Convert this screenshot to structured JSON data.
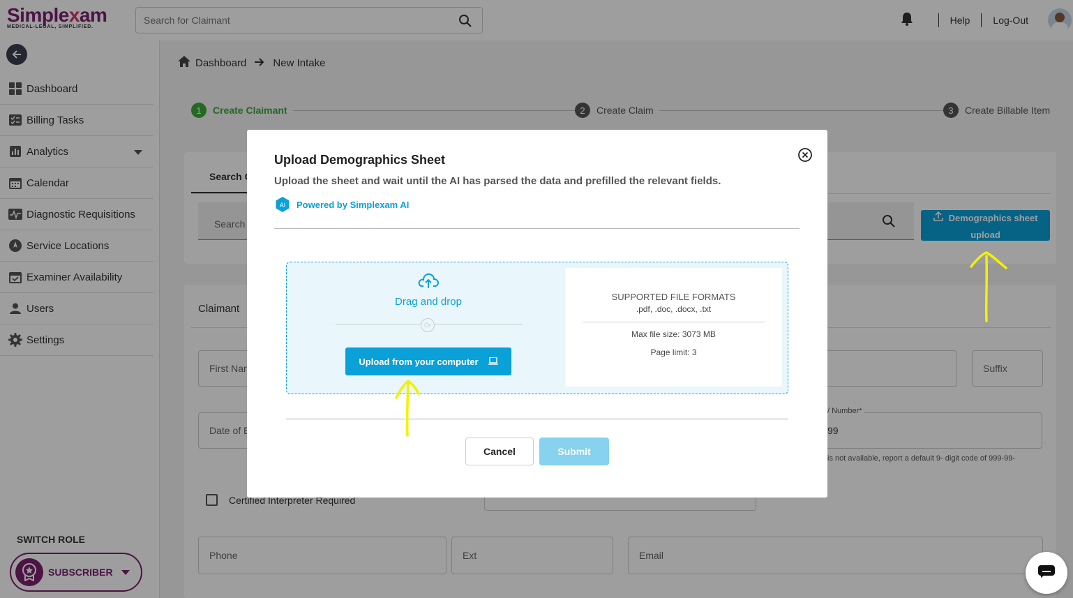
{
  "brand": {
    "name_part1": "Simple",
    "name_part2": "x",
    "name_part3": "am",
    "tagline": "MEDICAL-LEGAL, SIMPLIFIED.",
    "color": "#7b1f6e"
  },
  "header": {
    "search_placeholder": "Search for Claimant",
    "help": "Help",
    "logout": "Log-Out"
  },
  "sidebar": {
    "items": [
      {
        "label": "Dashboard",
        "icon": "grid-icon"
      },
      {
        "label": "Billing Tasks",
        "icon": "checklist-icon"
      },
      {
        "label": "Analytics",
        "icon": "bar-chart-icon"
      },
      {
        "label": "Calendar",
        "icon": "calendar-icon"
      },
      {
        "label": "Diagnostic Requisitions",
        "icon": "pulse-icon"
      },
      {
        "label": "Service Locations",
        "icon": "compass-icon"
      },
      {
        "label": "Examiner Availability",
        "icon": "calendar-check-icon"
      },
      {
        "label": "Users",
        "icon": "user-icon"
      },
      {
        "label": "Settings",
        "icon": "gear-icon"
      }
    ],
    "switch_role": "SWITCH ROLE",
    "role": "SUBSCRIBER"
  },
  "breadcrumb": {
    "home": "Dashboard",
    "current": "New Intake"
  },
  "stepper": [
    {
      "num": "1",
      "label": "Create Claimant"
    },
    {
      "num": "2",
      "label": "Create Claim"
    },
    {
      "num": "3",
      "label": "Create Billable Item"
    }
  ],
  "search_card": {
    "tab": "Search C",
    "search_placeholder": "Search",
    "demo_button_line1": "Demographics sheet",
    "demo_button_line2": "upload"
  },
  "claimant_card": {
    "title": "Claimant",
    "first_name": "First Nan",
    "suffix": "Suffix",
    "date_of_birth": "Date of E",
    "ssn_label": "/ Number*",
    "ssn_value": "99",
    "ssn_hint": "is not available, report a default 9- digit code of 999-99-",
    "interpreter": "Certified Interpreter Required",
    "phone": "Phone",
    "ext": "Ext",
    "email": "Email"
  },
  "modal": {
    "title": "Upload Demographics Sheet",
    "subtitle": "Upload the sheet and wait until the AI has parsed the data and prefilled the relevant fields.",
    "ai_badge": "AI",
    "powered_by": "Powered by Simplexam AI",
    "drag_drop": "Drag and drop",
    "or": "Or",
    "upload_button": "Upload from your computer",
    "formats_title": "SUPPORTED FILE FORMATS",
    "formats": ".pdf, .doc, .docx, .txt",
    "max_size": "Max file size: 3073 MB",
    "page_limit": "Page limit: 3",
    "cancel": "Cancel",
    "submit": "Submit"
  },
  "colors": {
    "accent": "#0aa0d8",
    "success": "#3aa83a",
    "annotation": "#f2f200"
  }
}
